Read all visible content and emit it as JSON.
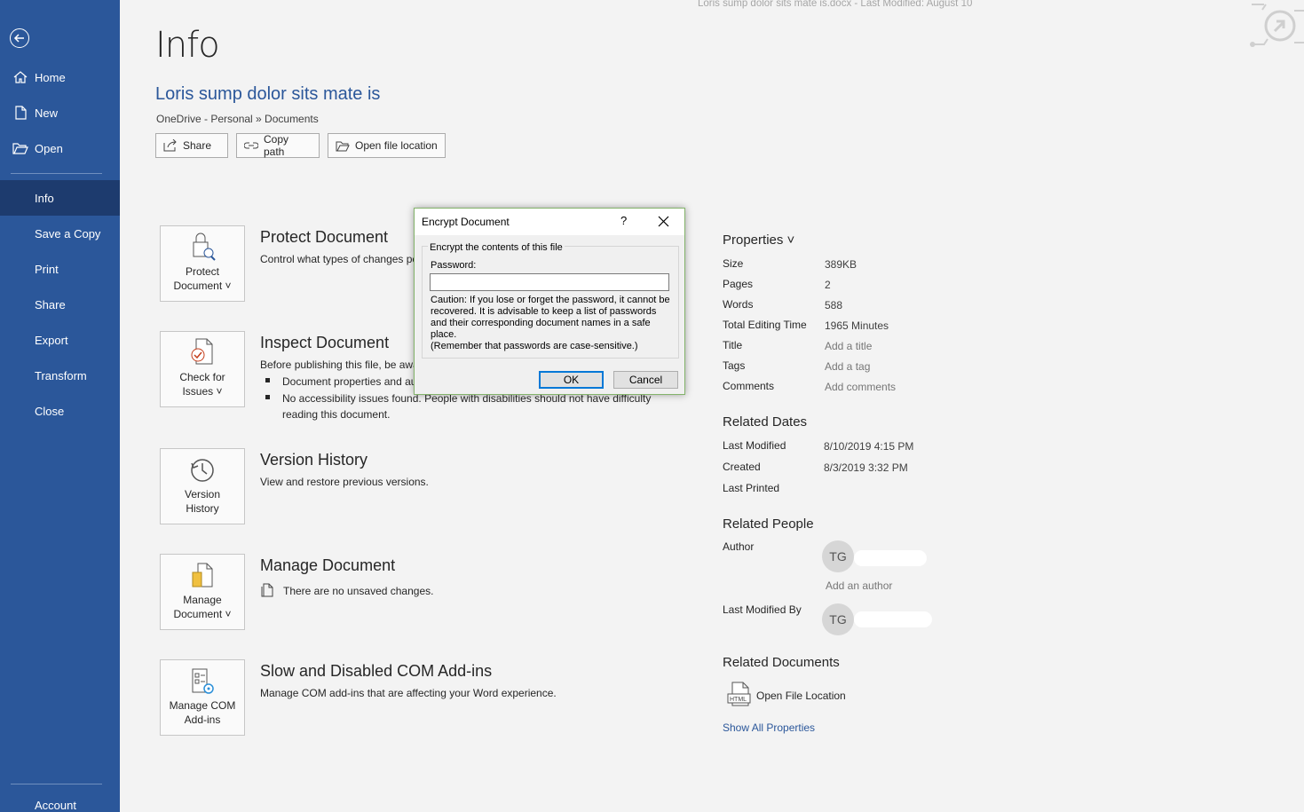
{
  "window": {
    "title": "Loris sump dolor sits mate is.docx  -  Last Modified: August 10"
  },
  "sidebar": {
    "items": [
      {
        "label": "Home"
      },
      {
        "label": "New"
      },
      {
        "label": "Open"
      },
      {
        "label": "Info",
        "active": true
      },
      {
        "label": "Save a Copy"
      },
      {
        "label": "Print"
      },
      {
        "label": "Share"
      },
      {
        "label": "Export"
      },
      {
        "label": "Transform"
      },
      {
        "label": "Close"
      }
    ],
    "account_label": "Account"
  },
  "header": {
    "page_title": "Info",
    "doc_name": "Loris sump dolor sits mate is",
    "doc_path": "OneDrive - Personal » Documents",
    "buttons": {
      "share": "Share",
      "copy_path": "Copy path",
      "open_location": "Open file location"
    }
  },
  "sections": {
    "protect": {
      "button": "Protect\nDocument ˅",
      "title": "Protect Document",
      "desc": "Control what types of changes pe"
    },
    "inspect": {
      "button": "Check for\nIssues ˅",
      "title": "Inspect Document",
      "desc": "Before publishing this file, be awa",
      "bullets": [
        "Document properties and au",
        "No accessibility issues found. People with disabilities should not have difficulty reading this document."
      ]
    },
    "version": {
      "button": "Version\nHistory",
      "title": "Version History",
      "desc": "View and restore previous versions."
    },
    "manage": {
      "button": "Manage\nDocument ˅",
      "title": "Manage Document",
      "desc": "There are no unsaved changes."
    },
    "com": {
      "button": "Manage COM\nAdd-ins",
      "title": "Slow and Disabled COM Add-ins",
      "desc": "Manage COM add-ins that are affecting your Word experience."
    }
  },
  "properties": {
    "heading": "Properties ˅",
    "size_label": "Size",
    "size": "389KB",
    "pages_label": "Pages",
    "pages": "2",
    "words_label": "Words",
    "words": "588",
    "editing_label": "Total Editing Time",
    "editing": "1965 Minutes",
    "title_label": "Title",
    "title_placeholder": "Add a title",
    "tags_label": "Tags",
    "tags_placeholder": "Add a tag",
    "comments_label": "Comments",
    "comments_placeholder": "Add comments"
  },
  "related_dates": {
    "heading": "Related Dates",
    "modified_label": "Last Modified",
    "modified": "8/10/2019 4:15 PM",
    "created_label": "Created",
    "created": "8/3/2019 3:32 PM",
    "printed_label": "Last Printed"
  },
  "related_people": {
    "heading": "Related People",
    "author_label": "Author",
    "author_initials": "TG",
    "add_author": "Add an author",
    "modified_by_label": "Last Modified By",
    "modified_by_initials": "TG"
  },
  "related_documents": {
    "heading": "Related Documents",
    "open_location": "Open File Location",
    "show_all": "Show All Properties"
  },
  "dialog": {
    "title": "Encrypt Document",
    "help": "?",
    "group_label": "Encrypt the contents of this file",
    "password_label": "Password:",
    "password_value": "",
    "caution": "Caution: If you lose or forget the password, it cannot be recovered. It is advisable to keep a list of passwords and their corresponding document names in a safe place.",
    "remember": "(Remember that passwords are case-sensitive.)",
    "ok": "OK",
    "cancel": "Cancel"
  },
  "colors": {
    "sidebar": "#2b579a",
    "sidebar_active": "#1d3b6e",
    "accent_link": "#2b579a",
    "dialog_border": "#83b36a"
  }
}
